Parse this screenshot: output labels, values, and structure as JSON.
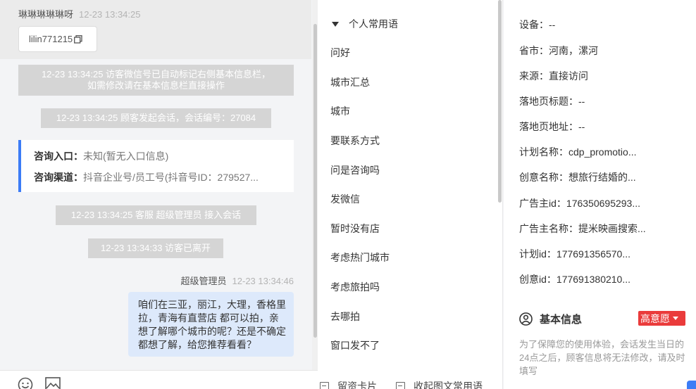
{
  "chat": {
    "visitor_name": "琳琳琳琳琳呀",
    "visitor_time": "12-23 13:34:25",
    "wechat_id": "lilin771215",
    "system_msg_1_line1": "12-23 13:34:25 访客微信号已自动标记右侧基本信息栏，",
    "system_msg_1_line2": "如需修改请在基本信息栏直接操作",
    "system_msg_2": "12-23 13:34:25 顾客发起会话，会话编号：27084",
    "consult_entry_label": "咨询入口：",
    "consult_entry_value": "未知(暂无入口信息)",
    "consult_channel_label": "咨询渠道：",
    "consult_channel_value": "抖音企业号/员工号(抖音号ID：279527...",
    "system_msg_3": "12-23 13:34:25 客服 超级管理员 接入会话",
    "system_msg_4": "12-23 13:34:33 访客已离开",
    "agent_name": "超级管理员",
    "agent_time": "12-23 13:34:46",
    "agent_message": "咱们在三亚，丽江，大理，香格里拉，青海有直营店 都可以拍，亲想了解哪个城市的呢？还是不确定都想了解，给您推荐看看？"
  },
  "phrases": {
    "header": "个人常用语",
    "items": [
      "问好",
      "城市汇总",
      "城市",
      "要联系方式",
      "问是咨询吗",
      "发微信",
      "暂时没有店",
      "考虑热门城市",
      "考虑旅拍吗",
      "去哪拍",
      "窗口发不了"
    ],
    "footer_left": "留资卡片",
    "footer_right": "收起图文常用语"
  },
  "info": {
    "rows": [
      {
        "k": "设备：",
        "v": "--"
      },
      {
        "k": "省市：",
        "v": "河南，漯河"
      },
      {
        "k": "来源：",
        "v": "直接访问"
      },
      {
        "k": "落地页标题：",
        "v": "--"
      },
      {
        "k": "落地页地址：",
        "v": "--"
      },
      {
        "k": "计划名称：",
        "v": "cdp_promotio..."
      },
      {
        "k": "创意名称：",
        "v": "想旅行结婚的..."
      },
      {
        "k": "广告主id：",
        "v": "176350695293..."
      },
      {
        "k": "广告主名称：",
        "v": "提米映画搜索..."
      },
      {
        "k": "计划id：",
        "v": "177691356570..."
      },
      {
        "k": "创意id：",
        "v": "177691380210..."
      }
    ],
    "basic_title": "基本信息",
    "intent_badge": "高意愿",
    "basic_note": "为了保障您的使用体验，会话发生当日的24点之后，顾客信息将无法修改，请及时填写"
  },
  "colors": {
    "accent_blue": "#3c7cf6",
    "badge_red": "#ea3b3b",
    "bubble_blue": "#dde9fb",
    "system_grey": "#d5d5d5"
  },
  "icons": [
    "copy-icon",
    "emoji-icon",
    "image-icon",
    "collapse-triangle-icon",
    "card-icon",
    "user-circle-icon",
    "caret-down-icon"
  ]
}
